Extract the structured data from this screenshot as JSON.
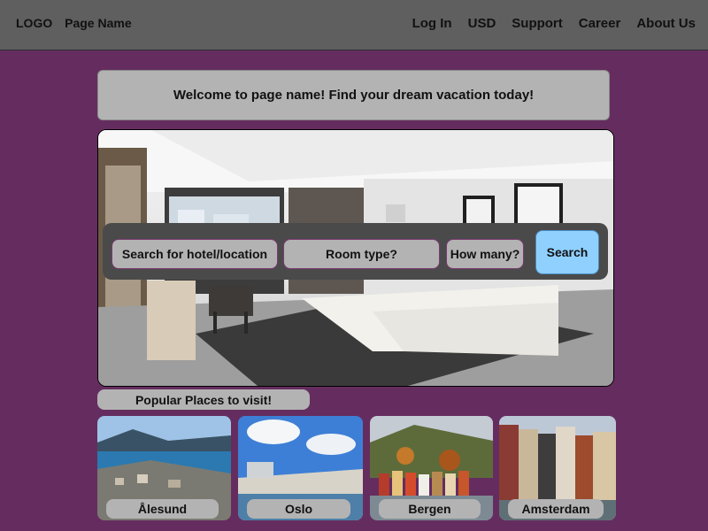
{
  "header": {
    "logo": "LOGO",
    "page_name": "Page Name",
    "nav": [
      "Log In",
      "USD",
      "Support",
      "Career",
      "About Us"
    ]
  },
  "welcome": {
    "text": "Welcome to page name! Find your dream vacation today!"
  },
  "search": {
    "location_placeholder": "Search for hotel/location",
    "room_type": "Room type?",
    "guests": "How many?",
    "button": "Search"
  },
  "popular": {
    "title": "Popular Places to visit!",
    "places": [
      "Ålesund",
      "Oslo",
      "Bergen",
      "Amsterdam"
    ]
  },
  "colors": {
    "background": "#652d5f",
    "header": "#5f5f5f",
    "panel": "#b3b3b3",
    "search_button": "#8fd0ff"
  }
}
